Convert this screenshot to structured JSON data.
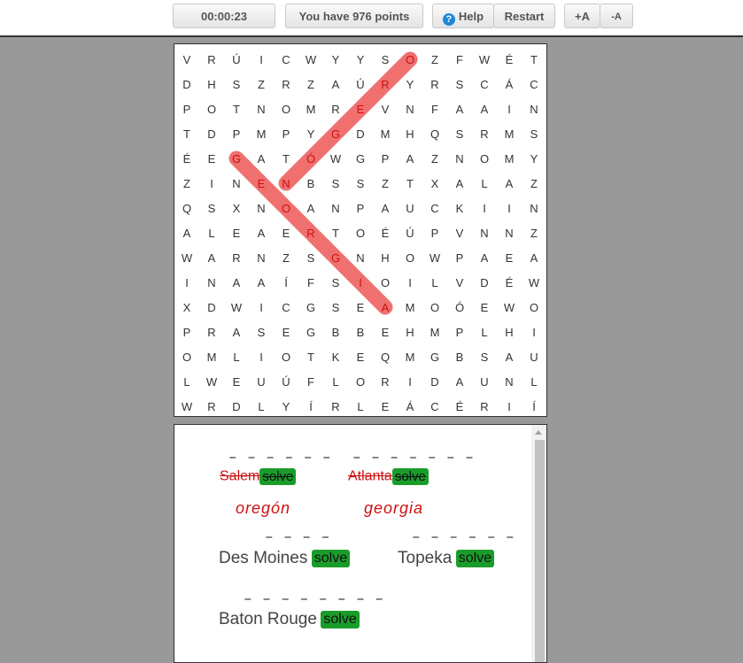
{
  "toolbar": {
    "timer": "00:00:23",
    "points": "You have 976 points",
    "help_label": "Help",
    "restart_label": "Restart",
    "font_up_label": "+A",
    "font_down_label": "-A"
  },
  "puzzle": {
    "grid": [
      [
        "V",
        "R",
        "Ú",
        "I",
        "C",
        "W",
        "Y",
        "Y",
        "S",
        "O",
        "Z",
        "F",
        "W",
        "É",
        "T"
      ],
      [
        "D",
        "H",
        "S",
        "Z",
        "R",
        "Z",
        "A",
        "Ú",
        "R",
        "Y",
        "R",
        "S",
        "C",
        "Á",
        "C"
      ],
      [
        "P",
        "O",
        "T",
        "N",
        "O",
        "M",
        "R",
        "E",
        "V",
        "N",
        "F",
        "A",
        "A",
        "I",
        "N"
      ],
      [
        "T",
        "D",
        "P",
        "M",
        "P",
        "Y",
        "G",
        "D",
        "M",
        "H",
        "Q",
        "S",
        "R",
        "M",
        "S"
      ],
      [
        "É",
        "E",
        "G",
        "A",
        "T",
        "Ó",
        "W",
        "G",
        "P",
        "A",
        "Z",
        "N",
        "O",
        "M",
        "Y"
      ],
      [
        "Z",
        "I",
        "N",
        "E",
        "N",
        "B",
        "S",
        "S",
        "Z",
        "T",
        "X",
        "A",
        "L",
        "A",
        "Z"
      ],
      [
        "Q",
        "S",
        "X",
        "N",
        "O",
        "A",
        "N",
        "P",
        "A",
        "U",
        "C",
        "K",
        "I",
        "I",
        "N"
      ],
      [
        "A",
        "L",
        "E",
        "A",
        "E",
        "R",
        "T",
        "O",
        "É",
        "Ú",
        "P",
        "V",
        "N",
        "N",
        "Z"
      ],
      [
        "W",
        "A",
        "R",
        "N",
        "Z",
        "S",
        "G",
        "N",
        "H",
        "O",
        "W",
        "P",
        "A",
        "E",
        "A"
      ],
      [
        "I",
        "N",
        "A",
        "A",
        "Í",
        "F",
        "S",
        "I",
        "O",
        "I",
        "L",
        "V",
        "D",
        "É",
        "W"
      ],
      [
        "X",
        "D",
        "W",
        "I",
        "C",
        "G",
        "S",
        "E",
        "A",
        "M",
        "O",
        "Ó",
        "E",
        "W",
        "O"
      ],
      [
        "P",
        "R",
        "A",
        "S",
        "E",
        "G",
        "B",
        "B",
        "E",
        "H",
        "M",
        "P",
        "L",
        "H",
        "I"
      ],
      [
        "O",
        "M",
        "L",
        "I",
        "O",
        "T",
        "K",
        "E",
        "Q",
        "M",
        "G",
        "B",
        "S",
        "A",
        "U"
      ],
      [
        "L",
        "W",
        "E",
        "U",
        "Ú",
        "F",
        "L",
        "O",
        "R",
        "I",
        "D",
        "A",
        "U",
        "N",
        "L"
      ],
      [
        "W",
        "R",
        "D",
        "L",
        "Y",
        "Í",
        "R",
        "L",
        "E",
        "Á",
        "C",
        "É",
        "R",
        "I",
        "Í"
      ]
    ],
    "found_words": [
      {
        "word": "oregón",
        "cells": [
          [
            0,
            9
          ],
          [
            1,
            8
          ],
          [
            2,
            7
          ],
          [
            3,
            6
          ],
          [
            4,
            5
          ],
          [
            5,
            4
          ]
        ]
      },
      {
        "word": "georgia",
        "cells": [
          [
            4,
            2
          ],
          [
            5,
            3
          ],
          [
            6,
            4
          ],
          [
            7,
            5
          ],
          [
            8,
            6
          ],
          [
            9,
            7
          ],
          [
            10,
            8
          ]
        ]
      }
    ],
    "highlight_color": "#f07070"
  },
  "clues": [
    {
      "label": "Salem",
      "dashes": "– – – – – –",
      "solve_label": "solve",
      "solved": true,
      "answer": "oregón"
    },
    {
      "label": "Atlanta",
      "dashes": "– – – – – – –",
      "solve_label": "solve",
      "solved": true,
      "answer": "georgia"
    },
    {
      "label": "Des Moines",
      "dashes": "– – – –",
      "solve_label": "solve",
      "solved": false
    },
    {
      "label": "Topeka",
      "dashes": "– – – – – –",
      "solve_label": "solve",
      "solved": false
    },
    {
      "label": "Baton Rouge",
      "dashes": "– – – – – – – –",
      "solve_label": "solve",
      "solved": false
    }
  ]
}
